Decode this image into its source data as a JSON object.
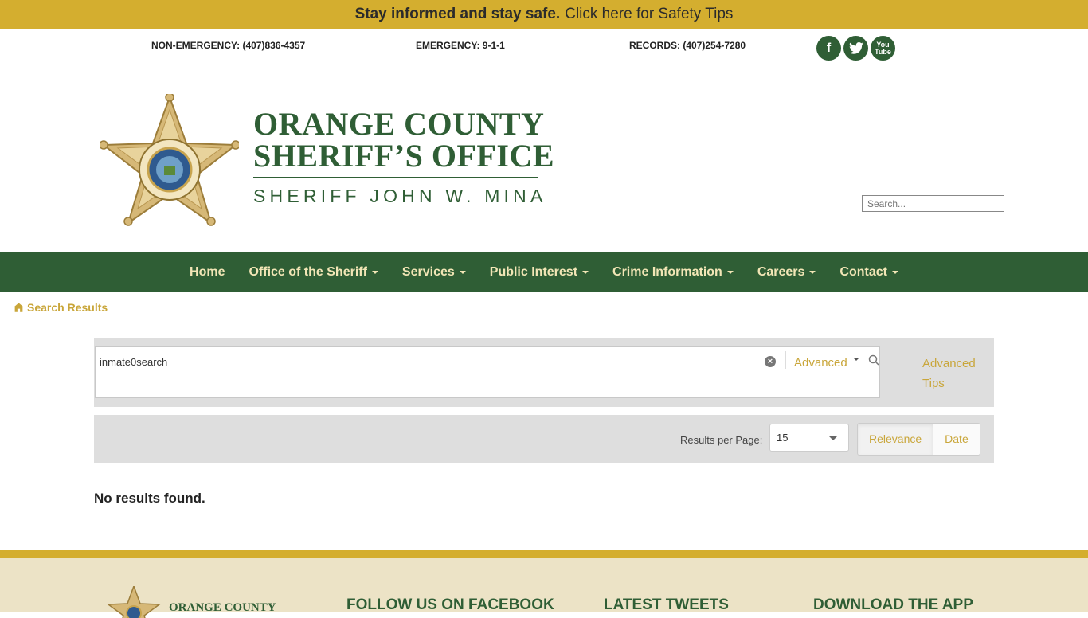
{
  "alert": {
    "lead": "Stay informed and stay safe.",
    "link": "Click here for Safety Tips"
  },
  "contacts": {
    "non_emergency": "NON-EMERGENCY: (407)836-4357",
    "emergency": "EMERGENCY: 9-1-1",
    "records": "RECORDS: (407)254-7280"
  },
  "social": {
    "facebook_icon": "f",
    "twitter_icon": "twitter-bird",
    "youtube_top": "You",
    "youtube_bottom": "Tube"
  },
  "logo": {
    "line1": "ORANGE COUNTY",
    "line2": "SHERIFF’S OFFICE",
    "subtitle": "SHERIFF JOHN W. MINA"
  },
  "site_search": {
    "placeholder": "Search..."
  },
  "nav": {
    "home": "Home",
    "office": "Office of the Sheriff",
    "services": "Services",
    "public_interest": "Public Interest",
    "crime_info": "Crime Information",
    "careers": "Careers",
    "contact": "Contact"
  },
  "breadcrumb": {
    "label": "Search Results"
  },
  "search": {
    "query": "inmate0search",
    "clear_glyph": "×",
    "advanced": "Advanced",
    "tips_line1": "Advanced",
    "tips_line2": "Tips"
  },
  "results": {
    "per_page_label": "Results per Page:",
    "per_page_value": "15",
    "sort_relevance": "Relevance",
    "sort_date": "Date",
    "message": "No results found."
  },
  "footer": {
    "logo_text": "ORANGE COUNTY",
    "facebook_heading": "FOLLOW US ON FACEBOOK",
    "tweets_heading": "LATEST TWEETS",
    "app_heading": "DOWNLOAD THE APP"
  },
  "colors": {
    "gold": "#d4ae2f",
    "green": "#2f5e35",
    "link_gold": "#c9a63a",
    "footer_bg": "#ece3c6"
  }
}
